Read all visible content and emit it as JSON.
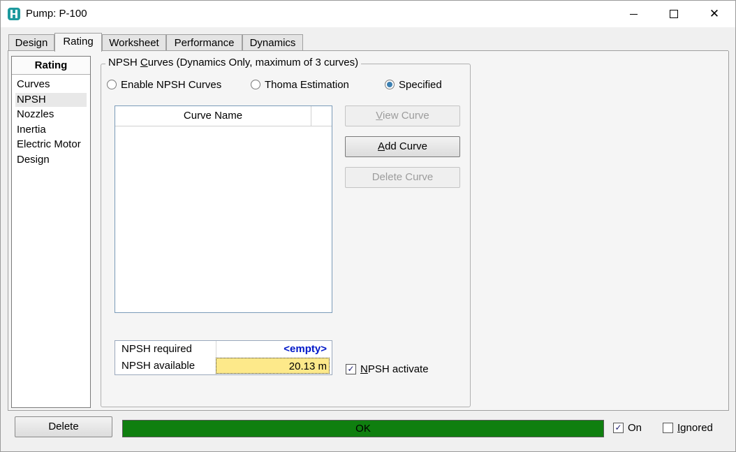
{
  "window": {
    "title": "Pump: P-100"
  },
  "tabs": [
    {
      "label": "Design"
    },
    {
      "label": "Rating"
    },
    {
      "label": "Worksheet"
    },
    {
      "label": "Performance"
    },
    {
      "label": "Dynamics"
    }
  ],
  "active_tab": "Rating",
  "nav": {
    "header": "Rating",
    "items": [
      "Curves",
      "NPSH",
      "Nozzles",
      "Inertia",
      "Electric Motor",
      "Design"
    ],
    "selected": "NPSH"
  },
  "npsh_group": {
    "title_pre": "NPSH ",
    "title_ul": "C",
    "title_post": "urves (Dynamics Only, maximum of 3 curves)",
    "radios": [
      {
        "label": "Enable NPSH Curves",
        "checked": false
      },
      {
        "label": "Thoma Estimation",
        "checked": false
      },
      {
        "label": "Specified",
        "checked": true
      }
    ],
    "list_header": "Curve Name",
    "buttons": {
      "view_ul": "V",
      "view_rest": "iew Curve",
      "add_ul": "A",
      "add_rest": "dd Curve",
      "delete": "Delete Curve"
    },
    "npsh_required_label": "NPSH required",
    "npsh_required_value": "<empty>",
    "npsh_available_label": "NPSH available",
    "npsh_available_value": "20.13 m",
    "activate_ul": "N",
    "activate_rest": "PSH activate",
    "activate_checked": true
  },
  "footer": {
    "delete_label": "Delete",
    "status_text": "OK",
    "status_color": "#0f7f0f",
    "on_label": "On",
    "on_checked": true,
    "ignored_ul": "I",
    "ignored_rest": "gnored",
    "ignored_checked": false
  }
}
